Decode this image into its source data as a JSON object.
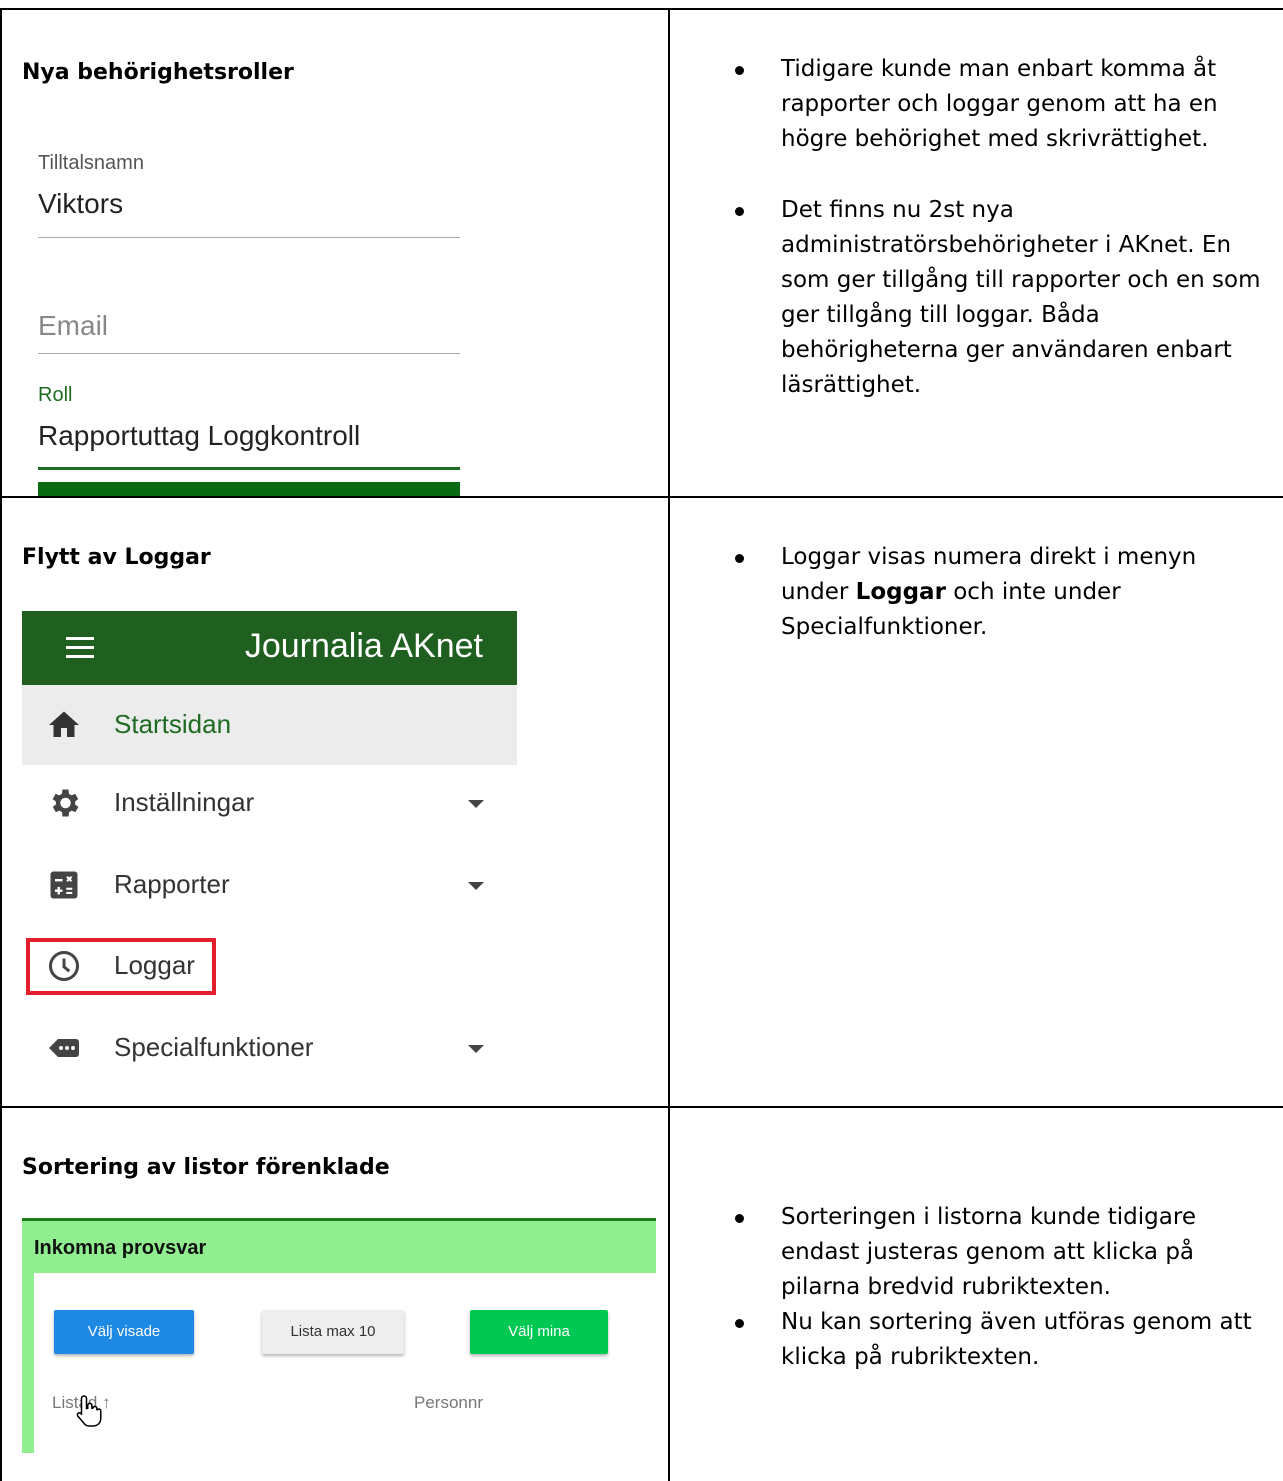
{
  "section1": {
    "title": "Nya behörighetsroller",
    "form": {
      "name_label": "Tilltalsnamn",
      "name_value": "Viktors",
      "email_placeholder": "Email",
      "role_label": "Roll",
      "role_value": "Rapportuttag Loggkontroll"
    },
    "bullets": [
      "Tidigare kunde man enbart komma åt rapporter och loggar genom att ha en högre behörighet med skrivrättighet.",
      "Det finns nu 2st nya administratörsbehörigheter i AKnet. En som ger tillgång till rapporter och en som ger tillgång till loggar. Båda behörigheterna ger användaren enbart läsrättighet."
    ]
  },
  "section2": {
    "title": "Flytt av Loggar",
    "nav": {
      "app_title": "Journalia AKnet",
      "items": [
        {
          "label": "Startsidan",
          "icon": "home-icon"
        },
        {
          "label": "Inställningar",
          "icon": "gear-icon"
        },
        {
          "label": "Rapporter",
          "icon": "calculator-icon"
        },
        {
          "label": "Loggar",
          "icon": "clock-icon"
        },
        {
          "label": "Specialfunktioner",
          "icon": "more-label-icon"
        }
      ]
    },
    "bullet_pre": "Loggar visas numera direkt i menyn under ",
    "bullet_bold": "Loggar",
    "bullet_post": " och inte under Specialfunktioner."
  },
  "section3": {
    "title": "Sortering av listor förenklade",
    "list": {
      "title": "Inkomna provsvar",
      "btn_select_shown": "Välj visade",
      "btn_list_max": "Lista max 10",
      "btn_select_mine": "Välj mina",
      "col_listed": "Listad",
      "col_personnr": "Personnr"
    },
    "bullets": [
      "Sorteringen i listorna kunde tidigare endast justeras genom att klicka på pilarna bredvid rubriktexten.",
      "Nu kan sortering även utföras genom att klicka på rubriktexten."
    ]
  },
  "colors": {
    "nav_header": "#1f5f1f",
    "active_green": "#1e6b22",
    "highlight_red": "#e21e2c",
    "list_green": "#90ee90"
  }
}
